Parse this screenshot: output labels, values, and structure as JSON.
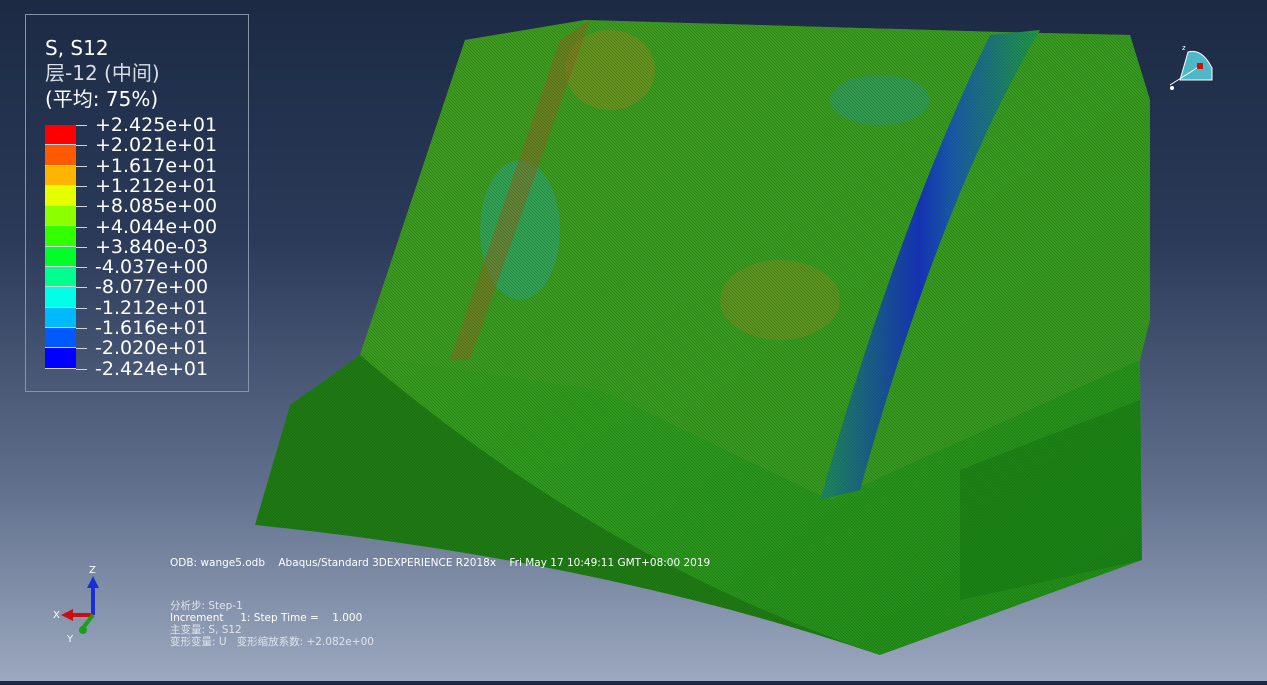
{
  "legend": {
    "title": "S, S12",
    "layer": "层-12 (中间)",
    "average": "(平均: 75%)",
    "levels": [
      {
        "label": "+2.425e+01",
        "color": "#ff0000"
      },
      {
        "label": "+2.021e+01",
        "color": "#ff5a00"
      },
      {
        "label": "+1.617e+01",
        "color": "#ffb400"
      },
      {
        "label": "+1.212e+01",
        "color": "#e6ff00"
      },
      {
        "label": "+8.085e+00",
        "color": "#8cff00"
      },
      {
        "label": "+4.044e+00",
        "color": "#32ff00"
      },
      {
        "label": "+3.840e-03",
        "color": "#00ff28"
      },
      {
        "label": "-4.037e+00",
        "color": "#00ff8c"
      },
      {
        "label": "-8.077e+00",
        "color": "#00ffe6"
      },
      {
        "label": "-1.212e+01",
        "color": "#00b9ff"
      },
      {
        "label": "-1.616e+01",
        "color": "#005aff"
      },
      {
        "label": "-2.020e+01",
        "color": "#0000ff"
      },
      {
        "label": "-2.424e+01",
        "color": "#0000ff"
      }
    ]
  },
  "info": {
    "odb": "ODB: wange5.odb    Abaqus/Standard 3DEXPERIENCE R2018x    Fri May 17 10:49:11 GMT+08:00 2019",
    "step": "分析步: Step-1",
    "increment": "Increment     1: Step Time =    1.000",
    "primary_var": "主变量: S, S12",
    "deformed_var": "变形变量: U   变形缩放系数: +2.082e+00"
  },
  "triad": {
    "x": "X",
    "y": "Y",
    "z": "Z"
  }
}
